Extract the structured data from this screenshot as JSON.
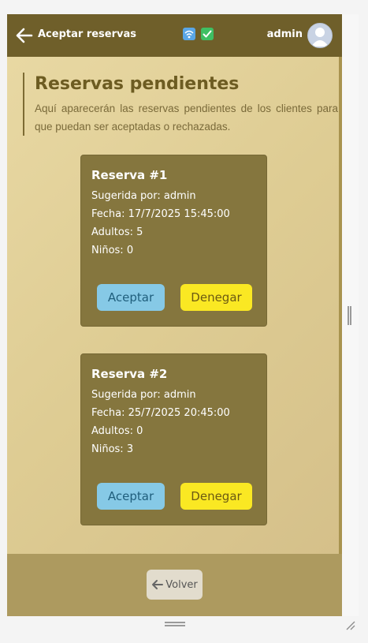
{
  "header": {
    "title": "Aceptar reservas",
    "user_name": "admin",
    "icons": [
      "back-arrow-icon",
      "wifi-icon",
      "check-icon",
      "user-avatar-icon"
    ],
    "color": "#6f5f2a"
  },
  "intro": {
    "heading": "Reservas pendientes",
    "description": "Aquí aparecerán las reservas pendientes de los clientes para que puedan ser aceptadas o rechazadas."
  },
  "reservations": [
    {
      "title": "Reserva #1",
      "suggested": "Sugerida por: admin",
      "date": "Fecha: 17/7/2025 15:45:00",
      "adults": "Adultos: 5",
      "children": "Niños: 0",
      "accept_label": "Aceptar",
      "deny_label": "Denegar"
    },
    {
      "title": "Reserva #2",
      "suggested": "Sugerida por: admin",
      "date": "Fecha: 25/7/2025 20:45:00",
      "adults": "Adultos: 0",
      "children": "Niños: 3",
      "accept_label": "Aceptar",
      "deny_label": "Denegar"
    }
  ],
  "footer": {
    "back_label": "Volver"
  },
  "colors": {
    "accept": "#86c9e6",
    "deny": "#fae823",
    "card": "#85763e"
  }
}
